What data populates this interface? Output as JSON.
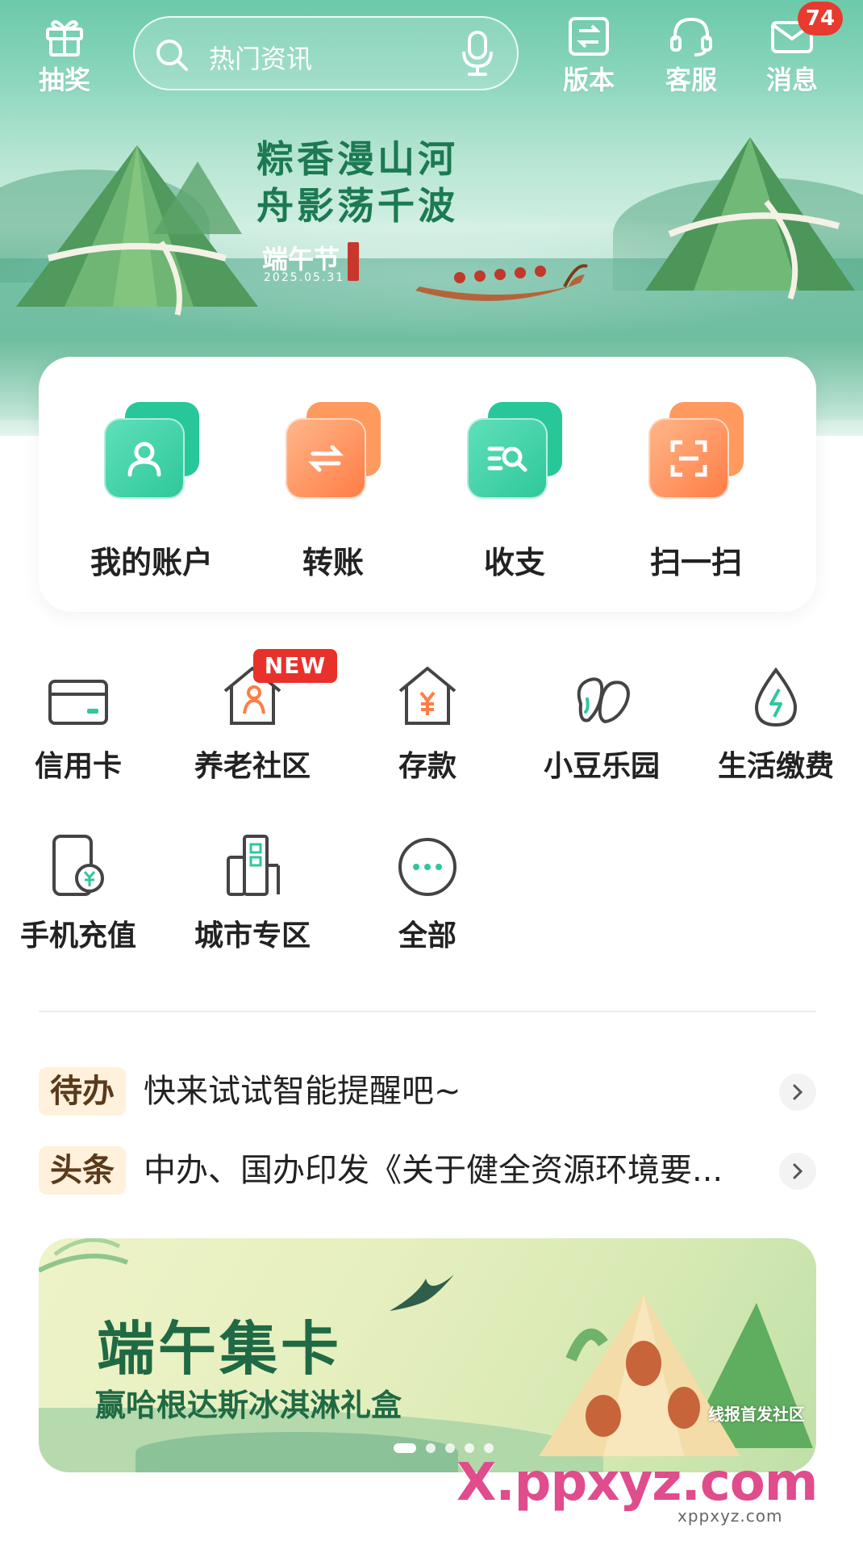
{
  "topbar": {
    "lottery_label": "抽奖",
    "search_placeholder": "热门资讯",
    "version_label": "版本",
    "service_label": "客服",
    "message_label": "消息",
    "message_badge": "74"
  },
  "hero": {
    "poem_line1": "粽香漫山河",
    "poem_line2": "舟影荡千波",
    "festival": "端午节",
    "date": "2025.05.31"
  },
  "quick_actions": [
    {
      "label": "我的账户",
      "icon": "user-icon",
      "color": "#27c79a"
    },
    {
      "label": "转账",
      "icon": "transfer-icon",
      "color": "#ff8a4c"
    },
    {
      "label": "收支",
      "icon": "ledger-search-icon",
      "color": "#27c79a"
    },
    {
      "label": "扫一扫",
      "icon": "scan-icon",
      "color": "#ff8a4c"
    }
  ],
  "services": [
    {
      "label": "信用卡",
      "icon": "credit-card-icon"
    },
    {
      "label": "养老社区",
      "icon": "elderly-community-icon",
      "badge": "NEW"
    },
    {
      "label": "存款",
      "icon": "deposit-house-icon"
    },
    {
      "label": "小豆乐园",
      "icon": "beans-icon"
    },
    {
      "label": "生活缴费",
      "icon": "utility-drop-icon"
    },
    {
      "label": "手机充值",
      "icon": "phone-recharge-icon"
    },
    {
      "label": "城市专区",
      "icon": "city-buildings-icon"
    },
    {
      "label": "全部",
      "icon": "more-icon"
    }
  ],
  "news": [
    {
      "tag": "待办",
      "text": "快来试试智能提醒吧~"
    },
    {
      "tag": "头条",
      "text": "中办、国办印发《关于健全资源环境要..."
    }
  ],
  "promo": {
    "title": "端午集卡",
    "subtitle": "赢哈根达斯冰淇淋礼盒"
  },
  "watermark": {
    "domain": "X.ppxyz.com",
    "caption": "线报首发社区",
    "caption2": "xppxyz.com"
  },
  "colors": {
    "accent_green": "#27c79a",
    "accent_orange": "#ff8a4c",
    "badge_red": "#e83a2f"
  }
}
